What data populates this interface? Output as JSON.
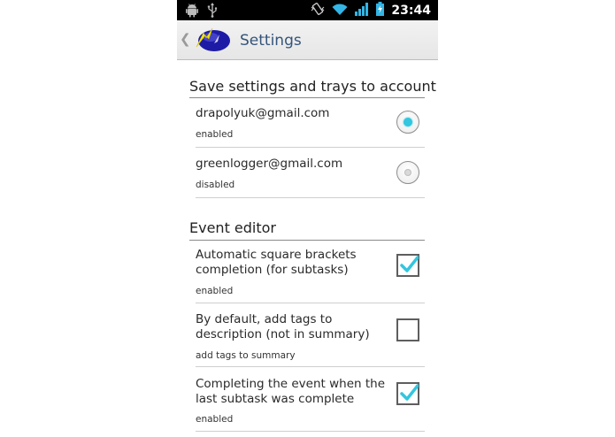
{
  "status_bar": {
    "time": "23:44",
    "left_icons": [
      "android-icon",
      "usb-icon"
    ],
    "right_icons": [
      "vibrate-icon",
      "wifi-icon",
      "signal-icon",
      "battery-charging-icon"
    ]
  },
  "action_bar": {
    "title": "Settings",
    "back_icon": "chevron-left-icon",
    "logo_icon": "app-logo-icon"
  },
  "sections": [
    {
      "header": "Save settings and trays to account",
      "items": [
        {
          "title": "drapolyuk@gmail.com",
          "summary": "enabled",
          "control": "radio",
          "checked": true
        },
        {
          "title": "greenlogger@gmail.com",
          "summary": "disabled",
          "control": "radio",
          "checked": false
        }
      ]
    },
    {
      "header": "Event editor",
      "items": [
        {
          "title_line1": "Automatic square brackets",
          "title_line2": "completion (for subtasks)",
          "summary": "enabled",
          "control": "checkbox",
          "checked": true
        },
        {
          "title_line1": "By default, add tags to",
          "title_line2": "description (not in summary)",
          "summary": "add tags to summary",
          "control": "checkbox",
          "checked": false
        },
        {
          "title_line1": "Completing the event when the",
          "title_line2": "last subtask was complete",
          "summary": "enabled",
          "control": "checkbox",
          "checked": true
        }
      ]
    }
  ],
  "colors": {
    "accent": "#32c6df",
    "title": "#34547a",
    "status_bar": "#000000"
  }
}
